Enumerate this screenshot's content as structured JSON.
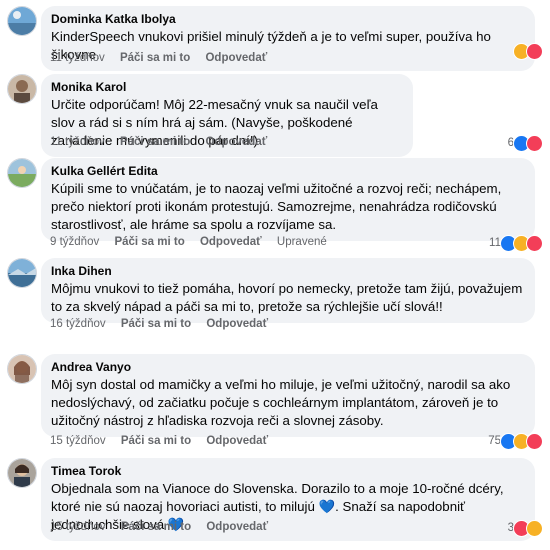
{
  "comments": [
    {
      "author": "Dominka Katka Ibolya",
      "text": "KinderSpeech vnukovi prišiel minulý týždeň a je to veľmi super, používa ho šikovne.",
      "time": "11 týždňov",
      "like_label": "Páči sa mi to",
      "reply_label": "Odpovedať",
      "edited_label": "",
      "reaction_count": "",
      "reactions": [
        "care",
        "love"
      ]
    },
    {
      "author": "Monika Karol",
      "text": "Určite odporúčam! Môj 22-mesačný vnuk sa naučil veľa slov a rád si s ním hrá aj sám. (Navyše, poškodené zariadenie mu vymenili do pár dní!)",
      "time": "11 týždňov",
      "like_label": "Páči sa mi to",
      "reply_label": "Odpovedať",
      "edited_label": "",
      "reaction_count": "6",
      "reactions": [
        "like",
        "love"
      ]
    },
    {
      "author": "Kulka Gellért Edita",
      "text": "Kúpili sme to vnúčatám, je to naozaj veľmi užitočné a rozvoj reči; nechápem, prečo niektorí proti ikonám protestujú. Samozrejme, nenahrádza rodičovskú starostlivosť, ale hráme sa spolu a rozvíjame sa.",
      "time": "9 týždňov",
      "like_label": "Páči sa mi to",
      "reply_label": "Odpovedať",
      "edited_label": "Upravené",
      "reaction_count": "11",
      "reactions": [
        "like",
        "haha",
        "love"
      ]
    },
    {
      "author": "Inka Dihen",
      "text": "Môjmu vnukovi to tiež pomáha, hovorí po nemecky, pretože tam žijú, považujem to za skvelý nápad a páči sa mi to, pretože sa rýchlejšie učí slová!!",
      "time": "16 týždňov",
      "like_label": "Páči sa mi to",
      "reply_label": "Odpovedať",
      "edited_label": "",
      "reaction_count": "",
      "reactions": []
    },
    {
      "author": "Andrea Vanyo",
      "text": "Môj syn dostal od mamičky a veľmi ho miluje, je veľmi užitočný, narodil sa ako nedoslýchavý, od začiatku počuje s cochleárnym implantátom, zároveň je to užitočný nástroj z hľadiska rozvoja reči a slovnej zásoby.",
      "time": "15 týždňov",
      "like_label": "Páči sa mi to",
      "reply_label": "Odpovedať",
      "edited_label": "",
      "reaction_count": "75",
      "reactions": [
        "like",
        "haha",
        "love"
      ]
    },
    {
      "author": "Timea Torok",
      "text": "Objednala som na Vianoce do Slovenska. Dorazilo to a moje 10-ročné dcéry, ktoré nie sú naozaj hovoriaci autisti, to milujú 💙. Snaží sa napodobniť jednoduchšie slová 💙",
      "time": "15 týždňov",
      "like_label": "Páči sa mi to",
      "reply_label": "Odpovedať",
      "edited_label": "",
      "reaction_count": "3",
      "reactions": [
        "love",
        "wow"
      ]
    }
  ],
  "colors": {
    "bubble": "#f0f2f5",
    "meta": "#65676b",
    "like": "#1877f2",
    "love": "#f33e58",
    "haha": "#f7b125"
  }
}
